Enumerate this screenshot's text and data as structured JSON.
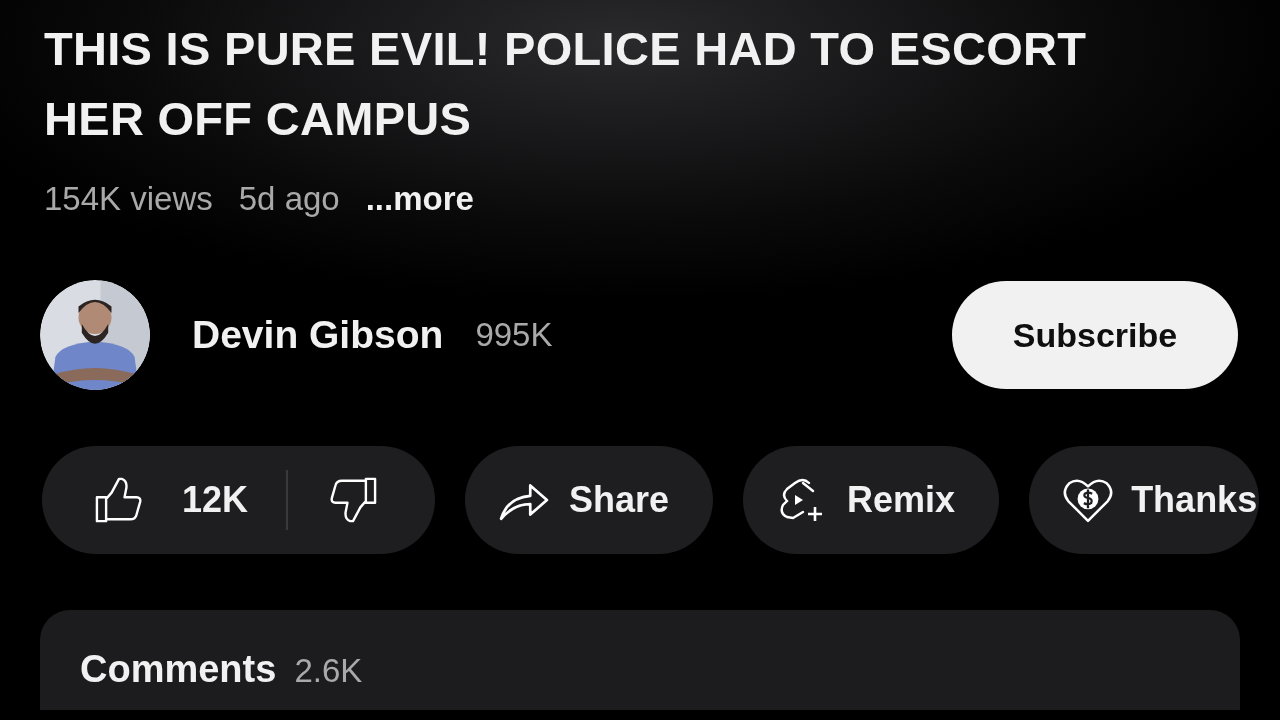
{
  "video": {
    "title": "THIS IS PURE EVIL! POLICE HAD TO ESCORT HER OFF CAMPUS",
    "views": "154K views",
    "age": "5d ago",
    "more": "...more"
  },
  "channel": {
    "name": "Devin Gibson",
    "subscribers": "995K",
    "subscribe_label": "Subscribe"
  },
  "actions": [
    {
      "kind": "like",
      "label": "12K"
    },
    {
      "kind": "share",
      "label": "Share"
    },
    {
      "kind": "remix",
      "label": "Remix"
    },
    {
      "kind": "thanks",
      "label": "Thanks"
    }
  ],
  "comments": {
    "label": "Comments",
    "count": "2.6K"
  }
}
